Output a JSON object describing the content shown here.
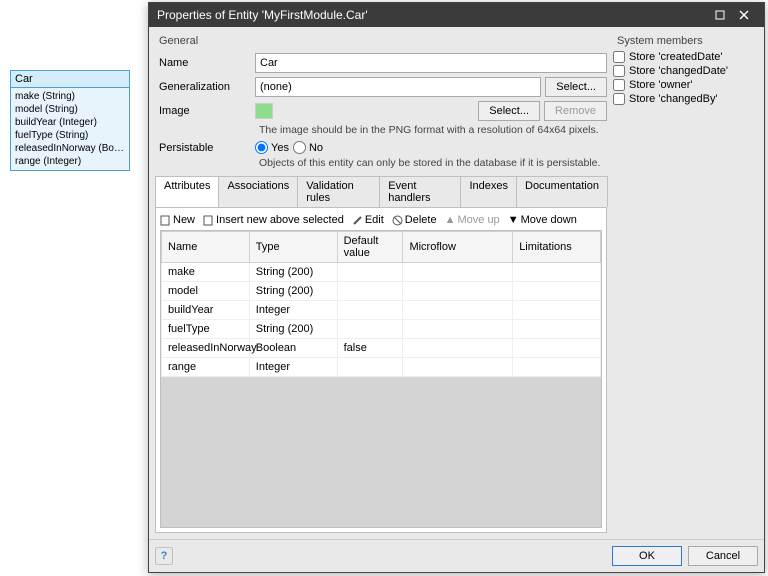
{
  "entity_box": {
    "name": "Car",
    "attrs": [
      "make (String)",
      "model (String)",
      "buildYear (Integer)",
      "fuelType (String)",
      "releasedInNorway (Boolea...",
      "range (Integer)"
    ]
  },
  "dialog": {
    "title": "Properties of Entity 'MyFirstModule.Car'"
  },
  "general": {
    "heading": "General",
    "name_label": "Name",
    "name_value": "Car",
    "gen_label": "Generalization",
    "gen_value": "(none)",
    "select_btn": "Select...",
    "image_label": "Image",
    "image_select": "Select...",
    "image_remove": "Remove",
    "image_hint": "The image should be in the PNG format with a resolution of 64x64 pixels.",
    "persist_label": "Persistable",
    "persist_yes": "Yes",
    "persist_no": "No",
    "persist_hint": "Objects of this entity can only be stored in the database if it is persistable."
  },
  "system_members": {
    "heading": "System members",
    "items": [
      "Store 'createdDate'",
      "Store 'changedDate'",
      "Store 'owner'",
      "Store 'changedBy'"
    ]
  },
  "tabs": [
    "Attributes",
    "Associations",
    "Validation rules",
    "Event handlers",
    "Indexes",
    "Documentation"
  ],
  "toolbar": {
    "new": "New",
    "insert": "Insert new above selected",
    "edit": "Edit",
    "delete": "Delete",
    "moveup": "Move up",
    "movedown": "Move down"
  },
  "grid": {
    "headers": [
      "Name",
      "Type",
      "Default value",
      "Microflow",
      "Limitations"
    ],
    "rows": [
      {
        "name": "make",
        "type": "String (200)",
        "default": "",
        "microflow": "",
        "limitations": ""
      },
      {
        "name": "model",
        "type": "String (200)",
        "default": "",
        "microflow": "",
        "limitations": ""
      },
      {
        "name": "buildYear",
        "type": "Integer",
        "default": "",
        "microflow": "",
        "limitations": ""
      },
      {
        "name": "fuelType",
        "type": "String (200)",
        "default": "",
        "microflow": "",
        "limitations": ""
      },
      {
        "name": "releasedInNorway",
        "type": "Boolean",
        "default": "false",
        "microflow": "",
        "limitations": ""
      },
      {
        "name": "range",
        "type": "Integer",
        "default": "",
        "microflow": "",
        "limitations": ""
      }
    ]
  },
  "footer": {
    "ok": "OK",
    "cancel": "Cancel"
  }
}
